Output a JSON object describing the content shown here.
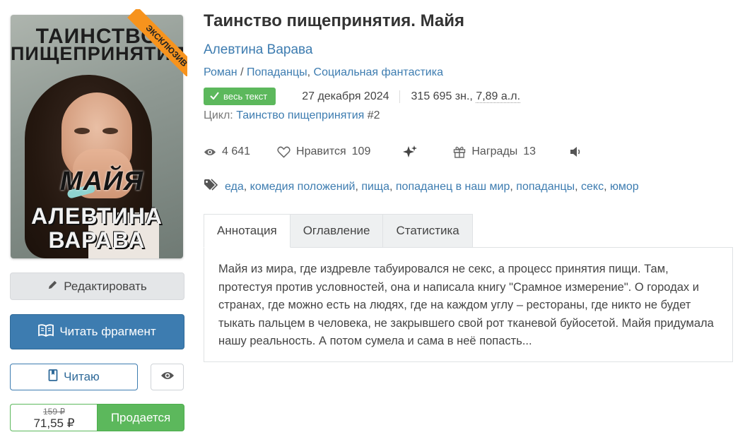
{
  "cover": {
    "ribbon": "ЭКСКЛЮЗИВ",
    "title_line1": "ТАИНСТВО",
    "title_line2": "ПИЩЕПРИНЯТИЯ",
    "name": "МАЙЯ",
    "author_line1": "АЛЕВТИНА",
    "author_line2": "ВАРАВА"
  },
  "actions": {
    "edit_label": "Редактировать",
    "read_fragment_label": "Читать фрагмент",
    "reading_label": "Читаю",
    "old_price": "159 ₽",
    "new_price": "71,55 ₽",
    "buy_label": "Продается"
  },
  "book": {
    "title": "Таинство пищепринятия. Майя",
    "author": "Алевтина Варава",
    "genres": [
      "Роман",
      "Попаданцы",
      "Социальная фантастика"
    ],
    "badge": "весь текст",
    "date": "27 декабря 2024",
    "size_chars": "315 695 зн.,",
    "size_al": "7,89 а.л.",
    "cycle_label": "Цикл:",
    "cycle_name": "Таинство пищепринятия",
    "cycle_num": "#2"
  },
  "stats": {
    "views": "4 641",
    "likes_label": "Нравится",
    "likes": "109",
    "awards_label": "Награды",
    "awards": "13"
  },
  "tags": [
    "еда",
    "комедия положений",
    "пища",
    "попаданец в наш мир",
    "попаданцы",
    "секс",
    "юмор"
  ],
  "tabs": [
    "Аннотация",
    "Оглавление",
    "Статистика"
  ],
  "annotation": "Майя из мира, где издревле табуировался не секс, а процесс принятия пищи. Там, протестуя против условностей, она и написала книгу \"Срамное измерение\". О городах и странах, где можно есть на людях, где на каждом углу – рестораны, где никто не будет тыкать пальцем в человека, не закрывшего свой рот тканевой буйосетой. Майя придумала нашу реальность. А потом сумела и сама в неё попасть...",
  "colors": {
    "link": "#3d7cb0",
    "green": "#5cb85c",
    "ribbon": "#f7931d"
  },
  "icons": [
    "pencil-icon",
    "book-open-icon",
    "bookmark-icon",
    "eye-icon",
    "check-icon",
    "heart-icon",
    "sparkles-icon",
    "gift-icon",
    "speaker-icon",
    "tag-icon"
  ]
}
